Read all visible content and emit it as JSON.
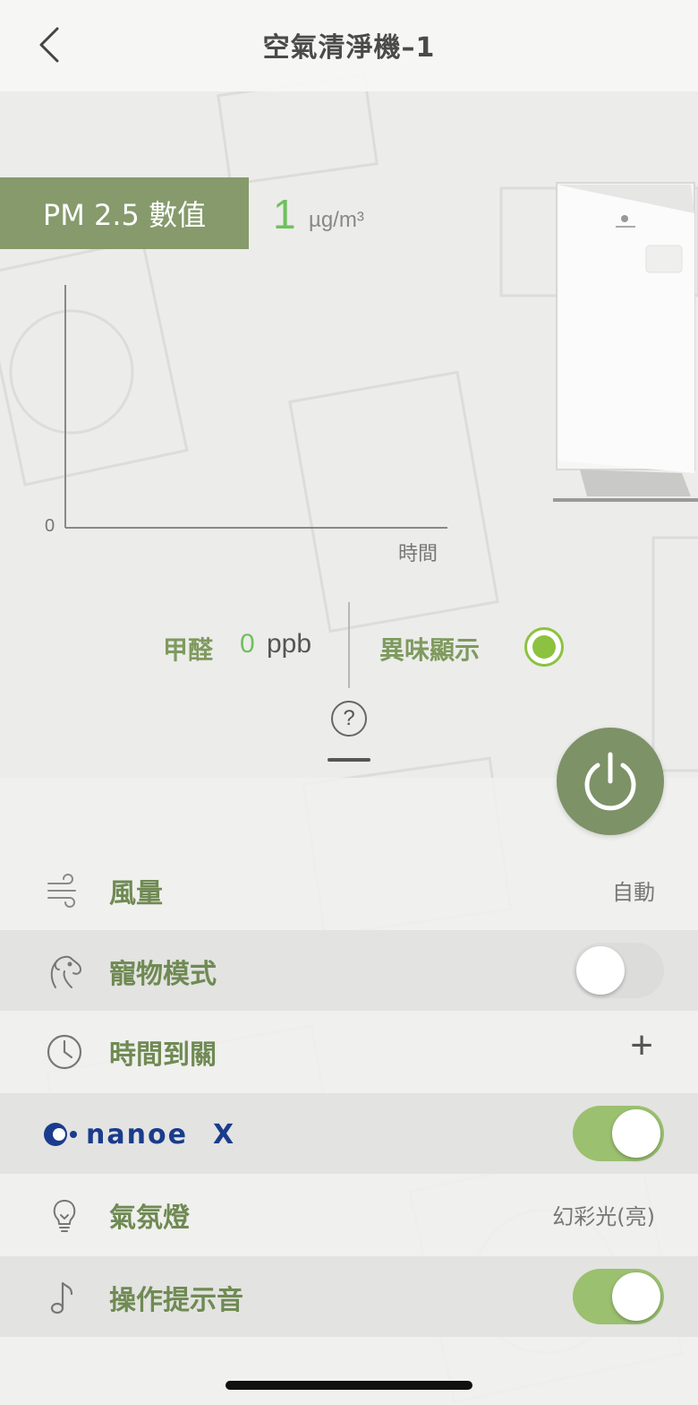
{
  "header": {
    "title": "空氣清淨機–1"
  },
  "pm25": {
    "label": "PM 2.5 數值",
    "value": "1",
    "unit": "µg/m³"
  },
  "chart": {
    "zero_label": "0",
    "x_label": "時間"
  },
  "formaldehyde": {
    "label": "甲醛",
    "value": "0",
    "unit": "ppb"
  },
  "odor": {
    "label": "異味顯示",
    "status_color": "#8cc23f"
  },
  "help": {
    "symbol": "?"
  },
  "controls": {
    "airflow": {
      "label": "風量",
      "value": "自動"
    },
    "pet_mode": {
      "label": "寵物模式",
      "enabled": false
    },
    "off_timer": {
      "label": "時間到關",
      "action": "+"
    },
    "nanoe": {
      "label": "nanoe X",
      "enabled": true
    },
    "mood_light": {
      "label": "氣氛燈",
      "value": "幻彩光(亮)"
    },
    "beep": {
      "label": "操作提示音",
      "enabled": true
    }
  },
  "colors": {
    "accent_green": "#869a6c",
    "value_green": "#6fc05f",
    "toggle_on": "#9bc06f",
    "nanoe_blue": "#1a3c8c"
  },
  "icons": [
    "back-chevron-icon",
    "power-icon",
    "wind-icon",
    "pet-icon",
    "clock-icon",
    "lightbulb-icon",
    "music-note-icon",
    "help-icon"
  ]
}
